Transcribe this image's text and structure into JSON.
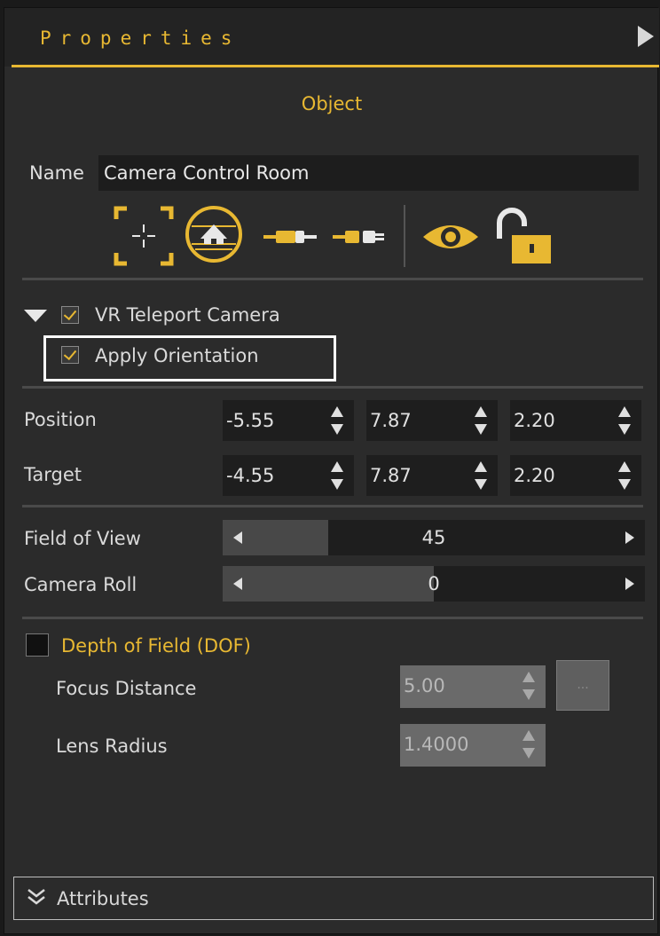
{
  "header": {
    "title": "Properties"
  },
  "object_section": {
    "title": "Object",
    "name_label": "Name",
    "name_value": "Camera Control Room"
  },
  "toolbar": {
    "icons": [
      "selection-bracket-icon",
      "scene-view-icon",
      "plug-in-icon",
      "plug-out-icon",
      "eye-icon",
      "unlock-icon"
    ]
  },
  "vr_teleport": {
    "label": "VR Teleport Camera",
    "checked": true,
    "apply_orientation_label": "Apply Orientation",
    "apply_orientation_checked": true
  },
  "position": {
    "label": "Position",
    "x": "-5.55",
    "y": "7.87",
    "z": "2.20"
  },
  "target": {
    "label": "Target",
    "x": "-4.55",
    "y": "7.87",
    "z": "2.20"
  },
  "field_of_view": {
    "label": "Field of View",
    "value": "45",
    "fraction": 0.25
  },
  "camera_roll": {
    "label": "Camera Roll",
    "value": "0",
    "fraction": 0.5
  },
  "dof": {
    "label": "Depth of Field (DOF)",
    "checked": false,
    "focus_distance_label": "Focus Distance",
    "focus_distance_value": "5.00",
    "lens_radius_label": "Lens Radius",
    "lens_radius_value": "1.4000",
    "ellipsis_label": "..."
  },
  "attributes": {
    "label": "Attributes"
  },
  "colors": {
    "accent": "#e8b832",
    "panel": "#2b2b2b",
    "field": "#1e1e1e"
  }
}
